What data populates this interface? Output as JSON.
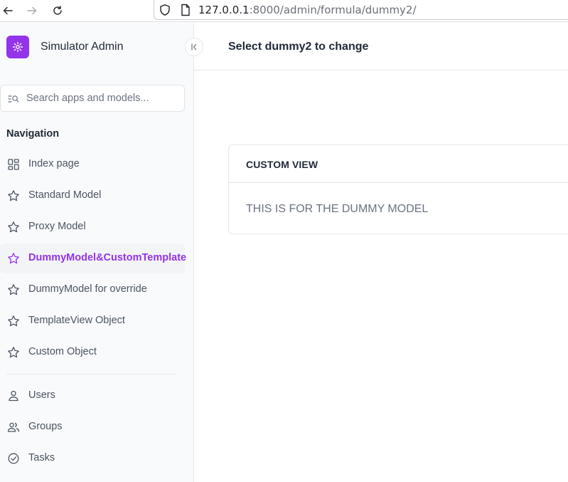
{
  "browser": {
    "url_host": "127.0.0.1",
    "url_rest": ":8000/admin/formula/dummy2/"
  },
  "sidebar": {
    "brand_name": "Simulator Admin",
    "search_placeholder": "Search apps and models...",
    "nav_heading": "Navigation",
    "items": [
      {
        "label": "Index page",
        "icon": "grid-icon"
      },
      {
        "label": "Standard Model",
        "icon": "star-icon"
      },
      {
        "label": "Proxy Model",
        "icon": "star-icon"
      },
      {
        "label": "DummyModel&CustomTemplate",
        "icon": "star-icon",
        "active": true
      },
      {
        "label": "DummyModel for override",
        "icon": "star-icon"
      },
      {
        "label": "TemplateView Object",
        "icon": "star-icon"
      },
      {
        "label": "Custom Object",
        "icon": "star-icon"
      }
    ],
    "auth_items": [
      {
        "label": "Users",
        "icon": "person-icon"
      },
      {
        "label": "Groups",
        "icon": "group-icon"
      },
      {
        "label": "Tasks",
        "icon": "check-circle-icon"
      }
    ]
  },
  "main": {
    "page_title": "Select dummy2 to change",
    "card_title": "CUSTOM VIEW",
    "card_body": "THIS IS FOR THE DUMMY MODEL"
  },
  "colors": {
    "accent": "#9333ea",
    "sidebar_bg": "#f9fafb",
    "border": "#e5e7eb"
  }
}
